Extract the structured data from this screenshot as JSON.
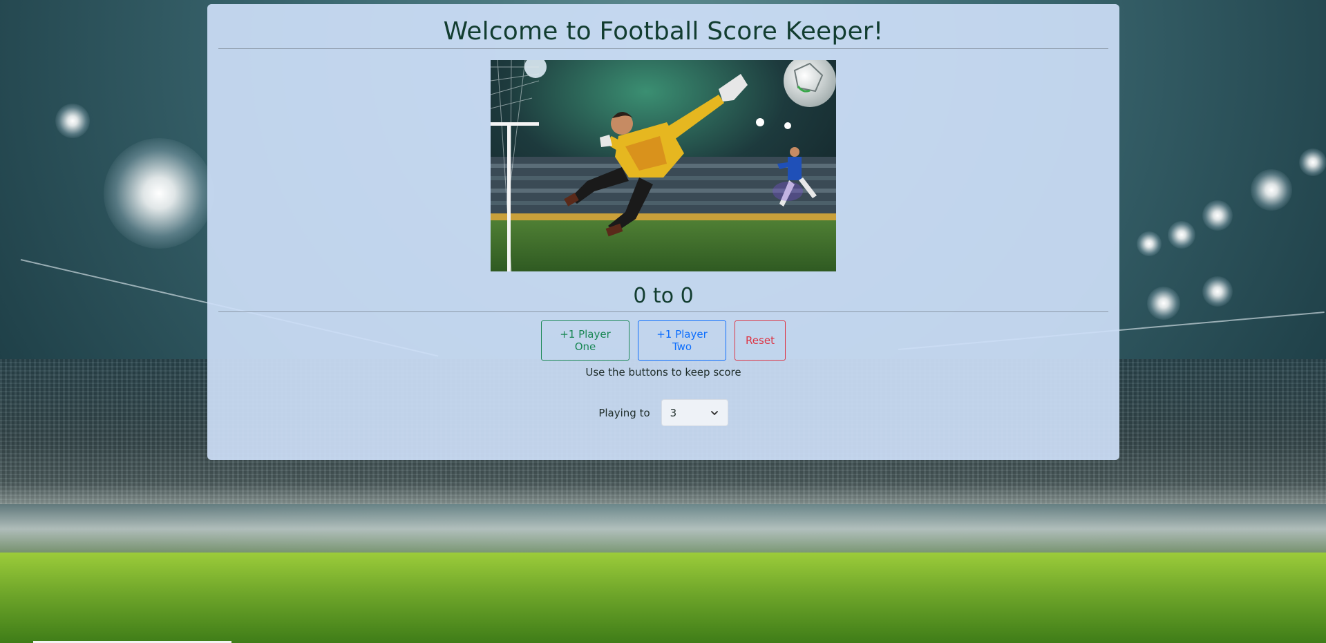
{
  "page": {
    "title": "Welcome to Football Score Keeper!",
    "hero_image": "goalkeeper diving to save football in stadium"
  },
  "score": {
    "player_one": 0,
    "player_two": 0,
    "display": "0 to 0"
  },
  "buttons": {
    "player_one_label": "+1 Player One",
    "player_two_label": "+1 Player Two",
    "reset_label": "Reset"
  },
  "hint": "Use the buttons to keep score",
  "playing_to": {
    "label": "Playing to",
    "selected": "3"
  },
  "colors": {
    "title": "#123d30",
    "player_one": "#198754",
    "player_two": "#0d6efd",
    "reset": "#dc3545",
    "panel": "#cddef7"
  },
  "icons": {
    "select_caret": "chevron-down-icon"
  }
}
